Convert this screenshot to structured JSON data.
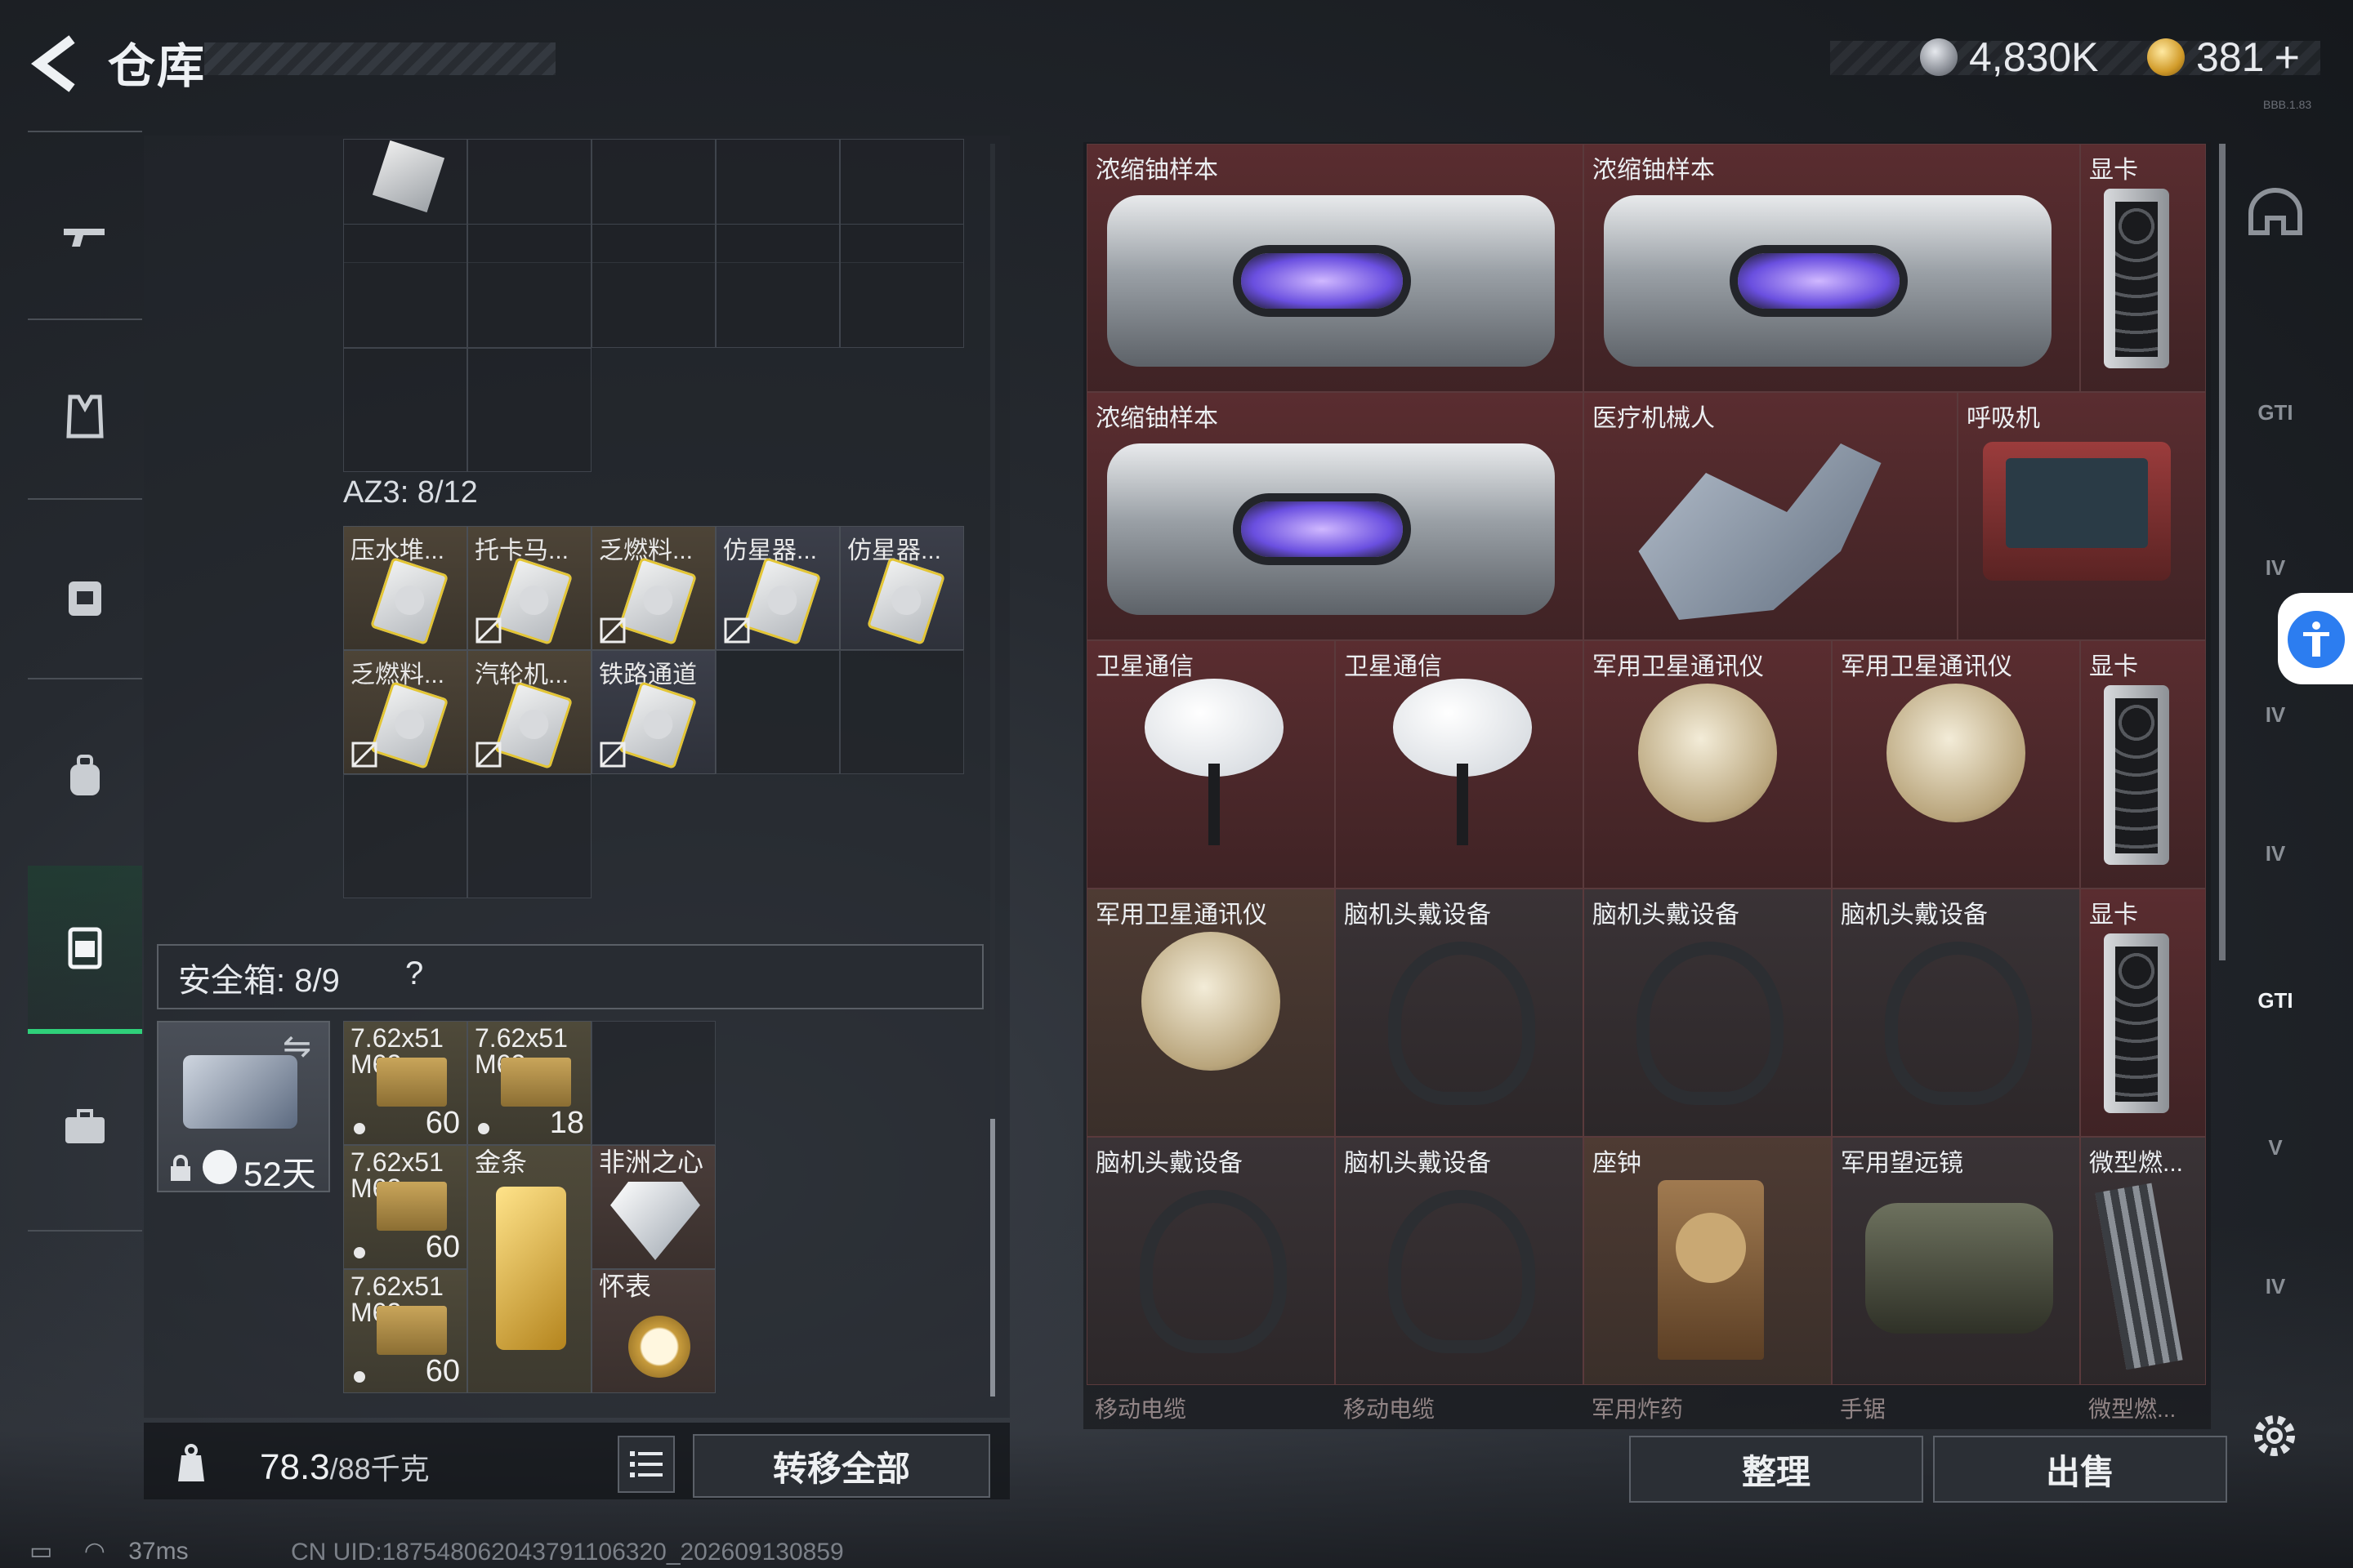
{
  "header": {
    "title": "仓库",
    "silver_amount": "4,830K",
    "gold_amount": "381",
    "plus_label": "+",
    "build_tag": "BBB.1.83"
  },
  "left_rail": {
    "items": [
      "weapon",
      "armor-vest",
      "chest-rig",
      "backpack",
      "safe-box",
      "briefcase"
    ],
    "active": "safe-box"
  },
  "storage": {
    "az3_label": "AZ3: 8/12",
    "az3_items": [
      {
        "name": "压水堆..."
      },
      {
        "name": "托卡马..."
      },
      {
        "name": "乏燃料..."
      },
      {
        "name": "仿星器..."
      },
      {
        "name": "仿星器..."
      },
      {
        "name": "乏燃料..."
      },
      {
        "name": "汽轮机..."
      },
      {
        "name": "铁路通道"
      }
    ]
  },
  "safe_box": {
    "label": "安全箱: 8/9",
    "help": "?",
    "swap_icon": "⇋",
    "days": "52天",
    "items": [
      {
        "name": "7.62x51\nM62",
        "count": "60"
      },
      {
        "name": "7.62x51\nM62",
        "count": "18"
      },
      {
        "name": "7.62x51\nM62",
        "count": "60"
      },
      {
        "name": "金条",
        "count": ""
      },
      {
        "name": "非洲之心",
        "count": ""
      },
      {
        "name": "7.62x51\nM62",
        "count": "60"
      },
      {
        "name": "怀表",
        "count": ""
      }
    ]
  },
  "footer_left": {
    "weight_value": "78.3",
    "weight_capacity": "/88千克",
    "transfer_all": "转移全部"
  },
  "inventory": {
    "items": [
      {
        "name": "浓缩铀样本"
      },
      {
        "name": "浓缩铀样本"
      },
      {
        "name": "显卡"
      },
      {
        "name": "浓缩铀样本"
      },
      {
        "name": "医疗机械人"
      },
      {
        "name": "呼吸机"
      },
      {
        "name": "卫星通信"
      },
      {
        "name": "卫星通信"
      },
      {
        "name": "军用卫星通讯仪"
      },
      {
        "name": "军用卫星通讯仪"
      },
      {
        "name": "显卡"
      },
      {
        "name": "军用卫星通讯仪"
      },
      {
        "name": "脑机头戴设备"
      },
      {
        "name": "脑机头戴设备"
      },
      {
        "name": "脑机头戴设备"
      },
      {
        "name": "显卡"
      },
      {
        "name": "脑机头戴设备"
      },
      {
        "name": "脑机头戴设备"
      },
      {
        "name": "座钟"
      },
      {
        "name": "军用望远镜"
      },
      {
        "name": "微型燃..."
      }
    ],
    "next_row": [
      "移动电缆",
      "移动电缆",
      "军用炸药",
      "手锯",
      "微型燃..."
    ]
  },
  "footer_right": {
    "arrange": "整理",
    "sell": "出售"
  },
  "right_rail": [
    "GTI",
    "IV",
    "IV",
    "IV",
    "GTI",
    "V",
    "IV"
  ],
  "status": {
    "ping": "37ms",
    "uid": "CN UID:187548062043791106320_202609130859"
  }
}
